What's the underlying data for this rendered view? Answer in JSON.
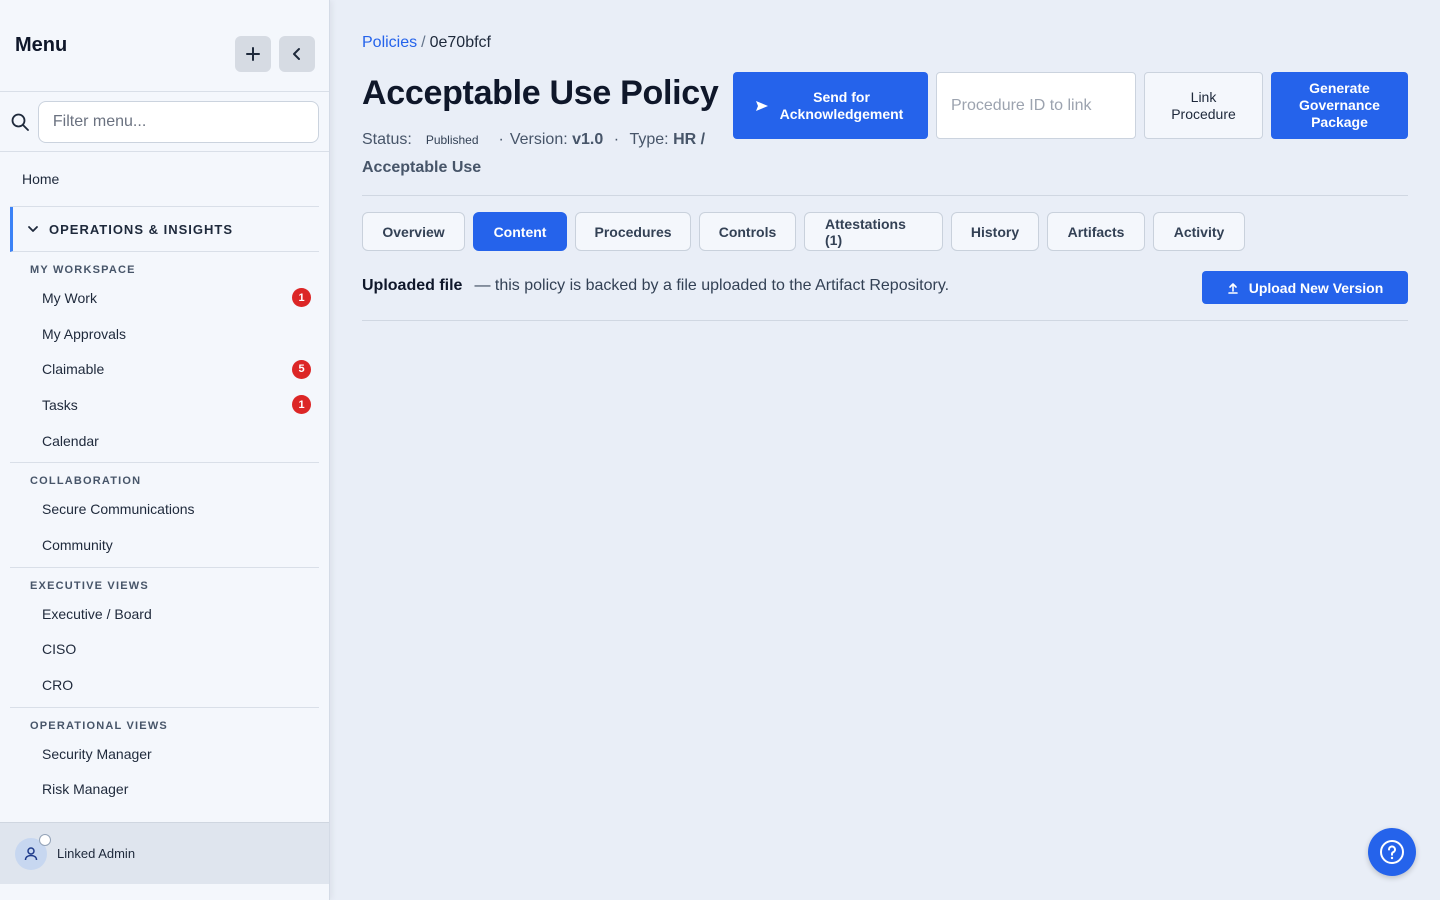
{
  "sidebar": {
    "title": "Menu",
    "filter_placeholder": "Filter menu...",
    "home": "Home",
    "group": "OPERATIONS & INSIGHTS",
    "sections": [
      {
        "title": "MY WORKSPACE",
        "items": [
          {
            "label": "My Work",
            "badge": "1"
          },
          {
            "label": "My Approvals",
            "badge": ""
          },
          {
            "label": "Claimable",
            "badge": "5"
          },
          {
            "label": "Tasks",
            "badge": "1"
          },
          {
            "label": "Calendar",
            "badge": ""
          }
        ]
      },
      {
        "title": "COLLABORATION",
        "items": [
          {
            "label": "Secure Communications"
          },
          {
            "label": "Community"
          }
        ]
      },
      {
        "title": "EXECUTIVE VIEWS",
        "items": [
          {
            "label": "Executive / Board"
          },
          {
            "label": "CISO"
          },
          {
            "label": "CRO"
          }
        ]
      },
      {
        "title": "OPERATIONAL VIEWS",
        "items": [
          {
            "label": "Security Manager"
          },
          {
            "label": "Risk Manager"
          }
        ]
      }
    ],
    "user_name": "Linked Admin"
  },
  "breadcrumb": {
    "parent": "Policies",
    "separator": "/",
    "current": "0e70bfcf"
  },
  "policy": {
    "title": "Acceptable Use Policy",
    "status_label": "Status:",
    "status": "Published",
    "version_label": "Version:",
    "version": "v1.0",
    "type_label": "Type:",
    "type": "HR / Acceptable Use"
  },
  "actions": {
    "send": "Send for Acknowledgement",
    "procedure_placeholder": "Procedure ID to link",
    "link": "Link Procedure",
    "generate": "Generate Governance Package"
  },
  "tabs": [
    "Overview",
    "Content",
    "Procedures",
    "Controls",
    "Attestations (1)",
    "History",
    "Artifacts",
    "Activity"
  ],
  "active_tab": "Content",
  "content": {
    "uploaded_label": "Uploaded file",
    "uploaded_text": "— this policy is backed by a file uploaded to the Artifact Repository.",
    "upload_button": "Upload New Version"
  },
  "colors": {
    "accent": "#2563eb",
    "badge": "#dc2626",
    "background": "#e9eef7"
  }
}
